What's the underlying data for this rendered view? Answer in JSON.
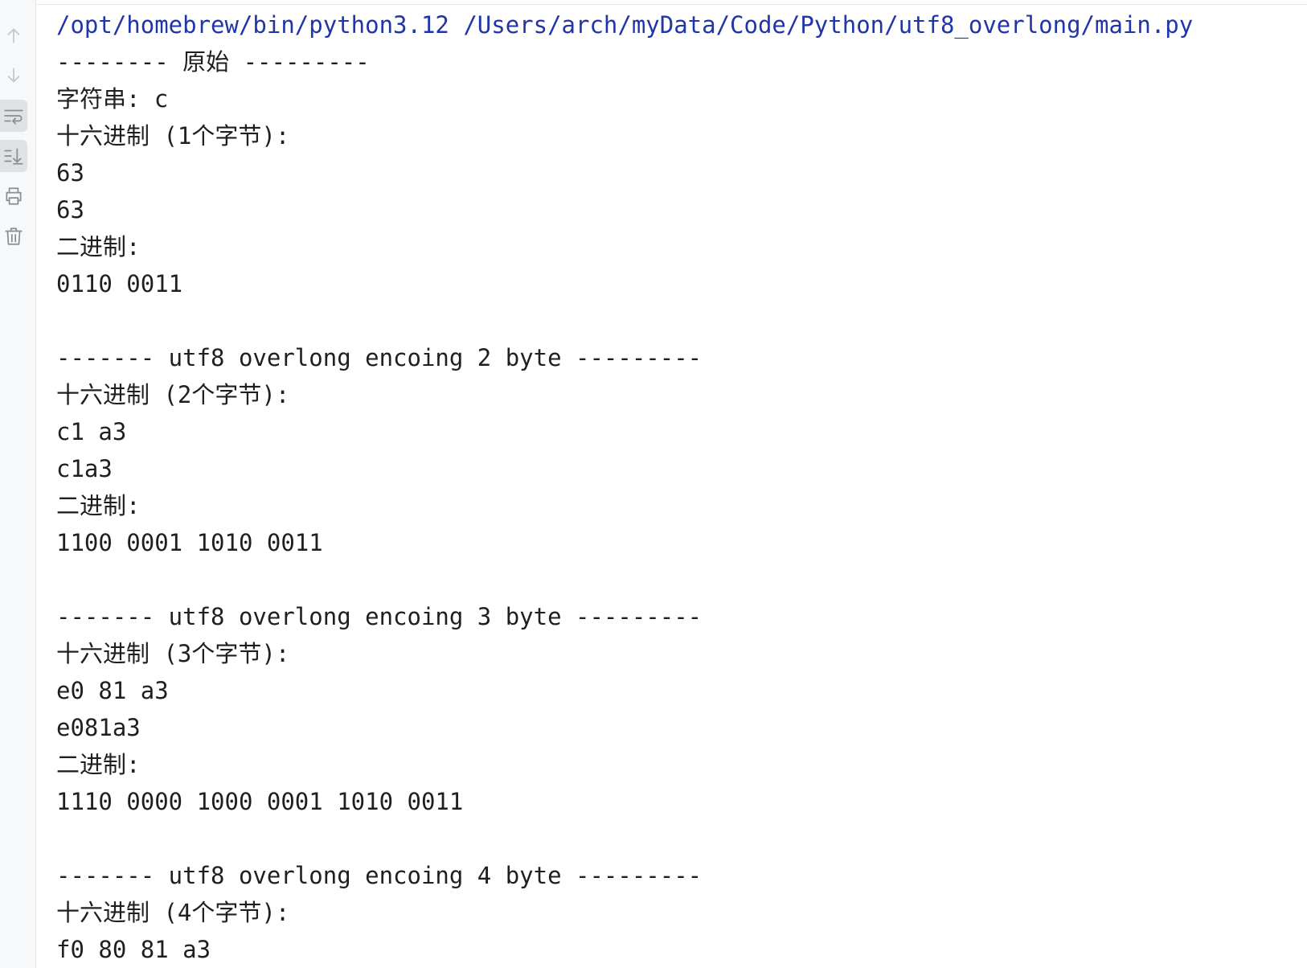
{
  "toolbar": {
    "icons": [
      "arrow-up-icon",
      "arrow-down-icon",
      "soft-wrap-icon",
      "scroll-to-end-icon",
      "print-icon",
      "trash-icon"
    ]
  },
  "console": {
    "command": "/opt/homebrew/bin/python3.12 /Users/arch/myData/Code/Python/utf8_overlong/main.py",
    "original_header": "-------- 原始 ---------",
    "string_line": "字符串: c",
    "hex_1_label": "十六进制 (1个字节):",
    "hex_1_spaced": "63",
    "hex_1_joined": "63",
    "bin_1_label": "二进制:",
    "bin_1_value": "0110 0011",
    "header_2": "------- utf8 overlong encoing 2 byte ---------",
    "hex_2_label": "十六进制 (2个字节):",
    "hex_2_spaced": "c1 a3",
    "hex_2_joined": "c1a3",
    "bin_2_label": "二进制:",
    "bin_2_value": "1100 0001 1010 0011",
    "header_3": "------- utf8 overlong encoing 3 byte ---------",
    "hex_3_label": "十六进制 (3个字节):",
    "hex_3_spaced": "e0 81 a3",
    "hex_3_joined": "e081a3",
    "bin_3_label": "二进制:",
    "bin_3_value": "1110 0000 1000 0001 1010 0011",
    "header_4": "------- utf8 overlong encoing 4 byte ---------",
    "hex_4_label": "十六进制 (4个字节):",
    "hex_4_spaced": "f0 80 81 a3"
  }
}
